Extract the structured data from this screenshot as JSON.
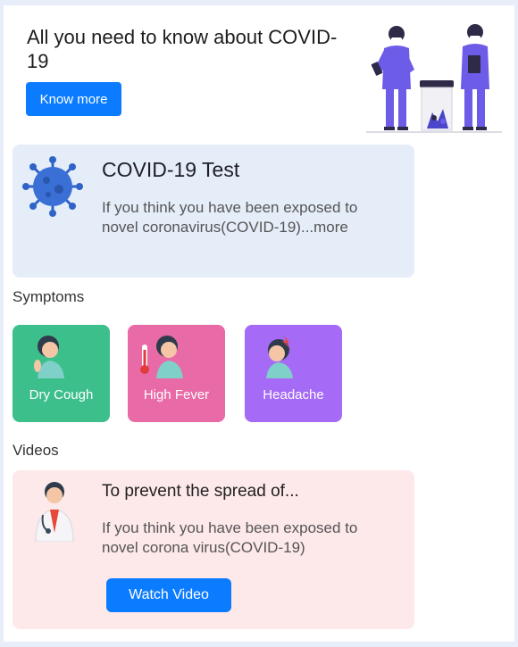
{
  "hero": {
    "title": "All you need to know about COVID-19",
    "button_label": "Know more",
    "illustration_icon": "doctors-with-vaccine-jar-illustration"
  },
  "test_card": {
    "title": "COVID-19 Test",
    "description": "If you think you have been exposed to novel coronavirus(COVID-19)...more",
    "icon": "virus-icon"
  },
  "symptoms": {
    "section_label": "Symptoms",
    "items": [
      {
        "label": "Dry Cough",
        "icon": "coughing-person-icon",
        "color": "#3dbf8c"
      },
      {
        "label": "High Fever",
        "icon": "fever-thermometer-icon",
        "color": "#e86aa7"
      },
      {
        "label": "Headache",
        "icon": "headache-person-icon",
        "color": "#a56af6"
      }
    ]
  },
  "videos": {
    "section_label": "Videos",
    "card": {
      "title": "To prevent the spread of...",
      "description": "If you think you have been exposed to novel corona virus(COVID-19)",
      "button_label": "Watch Video",
      "icon": "doctor-icon"
    }
  },
  "colors": {
    "accent": "#0b7cff",
    "test_card_bg": "#e5edf9",
    "video_card_bg": "#fde8ea",
    "page_bg": "#e8eef9"
  }
}
